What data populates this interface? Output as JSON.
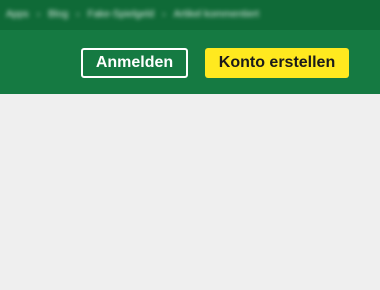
{
  "breadcrumb": {
    "items": [
      "Apps",
      "Blog",
      "Fake-Spielgeld",
      "Artikel kommentiert"
    ],
    "separator": "›"
  },
  "header": {
    "login_label": "Anmelden",
    "register_label": "Konto erstellen"
  },
  "colors": {
    "header_green": "#157a42",
    "register_yellow": "#ffe91f",
    "page_background": "#efefef"
  }
}
